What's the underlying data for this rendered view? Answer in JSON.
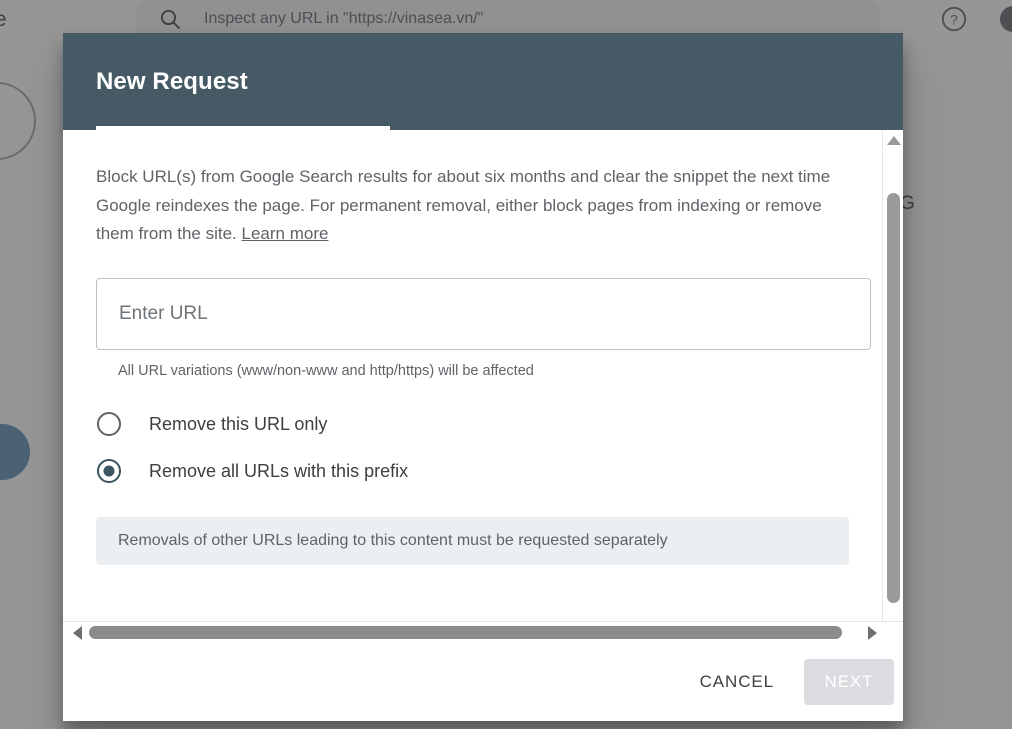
{
  "background": {
    "brand": "nsole",
    "search": {
      "icon": "search-icon",
      "placeholder": "Inspect any URL in \"https://vinasea.vn/\""
    },
    "help_icon": "help-circle-icon",
    "fragment_letter": "G"
  },
  "dialog": {
    "title": "New Request",
    "description_part1": "Block URL(s) from Google Search results for about six months and clear the snippet the next time Google reindexes the page. For permanent removal, either block pages from indexing or remove them from the site. ",
    "learn_more": "Learn more",
    "url_input": {
      "placeholder": "Enter URL",
      "value": ""
    },
    "helper_text": "All URL variations (www/non-www and http/https) will be affected",
    "options": [
      {
        "label": "Remove this URL only",
        "selected": false
      },
      {
        "label": "Remove all URLs with this prefix",
        "selected": true
      }
    ],
    "info_note": "Removals of other URLs leading to this content must be requested separately",
    "footer": {
      "cancel_label": "CANCEL",
      "next_label": "NEXT"
    },
    "colors": {
      "header_bg": "#465a65",
      "radio_selected": "#3c5560",
      "info_bg": "#eceff1",
      "next_disabled_bg": "#dadce0"
    }
  },
  "scrollbars": {
    "vertical": {
      "up_icon": "triangle-up-icon",
      "down_icon": "triangle-down-icon"
    },
    "horizontal": {
      "left_icon": "triangle-left-icon",
      "right_icon": "triangle-right-icon"
    }
  }
}
